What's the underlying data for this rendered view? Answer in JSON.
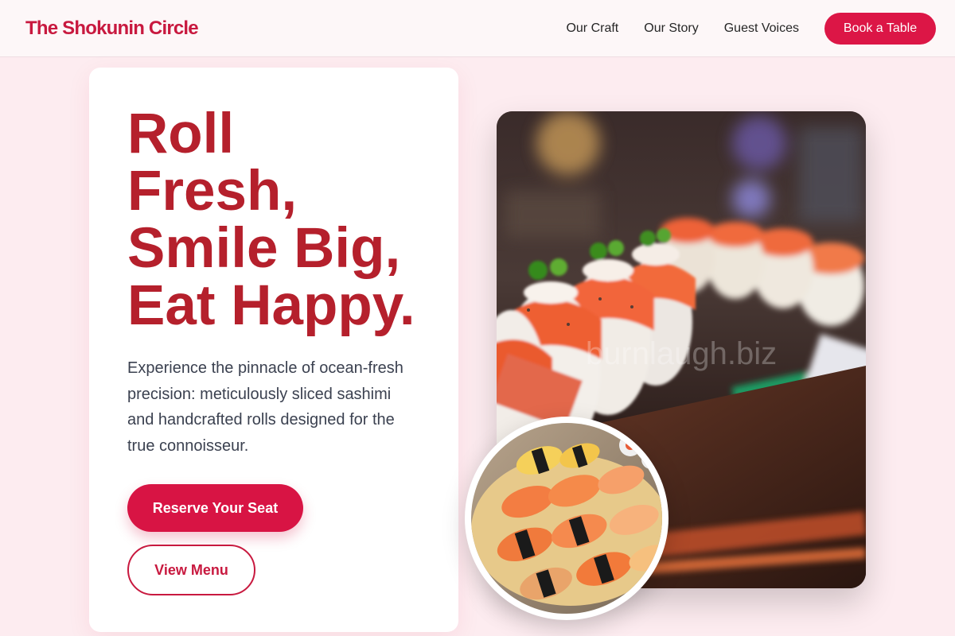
{
  "brand": {
    "name": "The Shokunin Circle"
  },
  "nav": {
    "links": [
      "Our Craft",
      "Our Story",
      "Guest Voices"
    ],
    "cta": "Book a Table"
  },
  "hero": {
    "headline": [
      "Roll",
      "Fresh,",
      "Smile Big,",
      "Eat Happy."
    ],
    "lede": "Experience the pinnacle of ocean-fresh precision: meticulously sliced sashimi and handcrafted rolls designed for the true connoisseur.",
    "primary_cta": "Reserve Your Seat",
    "secondary_cta": "View Menu"
  },
  "images": {
    "main": {
      "subject": "sushi-rolls-on-wooden-board",
      "watermark": "burnlaugh.biz"
    },
    "inset": {
      "subject": "nigiri-sushi-platter"
    }
  },
  "colors": {
    "accent": "#dc1646",
    "brand_text": "#c8193f",
    "headline": "#b5202c",
    "page_background": "#fdecf0"
  }
}
